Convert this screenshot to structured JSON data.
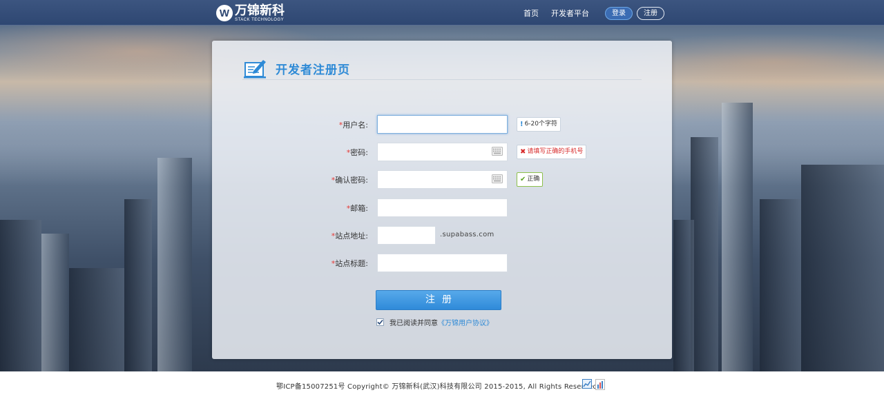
{
  "header": {
    "logo_cn": "万锦新科",
    "logo_en": "STACK TECHNOLOGY",
    "logo_letter": "W",
    "nav": {
      "home": "首页",
      "developer_platform": "开发者平台"
    },
    "login_label": "登录",
    "register_label": "注册"
  },
  "panel": {
    "title": "开发者注册页",
    "fields": {
      "username": {
        "required": "*",
        "label": "用户名:",
        "value": "",
        "tip": "6-20个字符",
        "tip_icon": "!"
      },
      "password": {
        "required": "*",
        "label": "密码:",
        "value": "",
        "tip": "请填写正确的手机号",
        "tip_icon": "✖"
      },
      "confirm_password": {
        "required": "*",
        "label": "确认密码:",
        "value": "",
        "tip": "正确",
        "tip_icon": "✔"
      },
      "email": {
        "required": "*",
        "label": "邮箱:",
        "value": ""
      },
      "site_address": {
        "required": "*",
        "label": "站点地址:",
        "value": "",
        "suffix": ".supabass.com"
      },
      "site_title": {
        "required": "*",
        "label": "站点标题:",
        "value": ""
      }
    },
    "submit_label": "注册",
    "agree_prefix": "我已阅读并同意",
    "agree_link": "《万锦用户协议》",
    "agree_checked": true
  },
  "footer": {
    "text": "鄂ICP备15007251号 Copyright© 万锦新科(武汉)科技有限公司 2015-2015, All Rights Reserved."
  },
  "colors": {
    "header_bg": "#2e4772",
    "accent": "#2e8ad6",
    "error": "#d72b2b",
    "success": "#5aa321",
    "required": "#e53935"
  }
}
